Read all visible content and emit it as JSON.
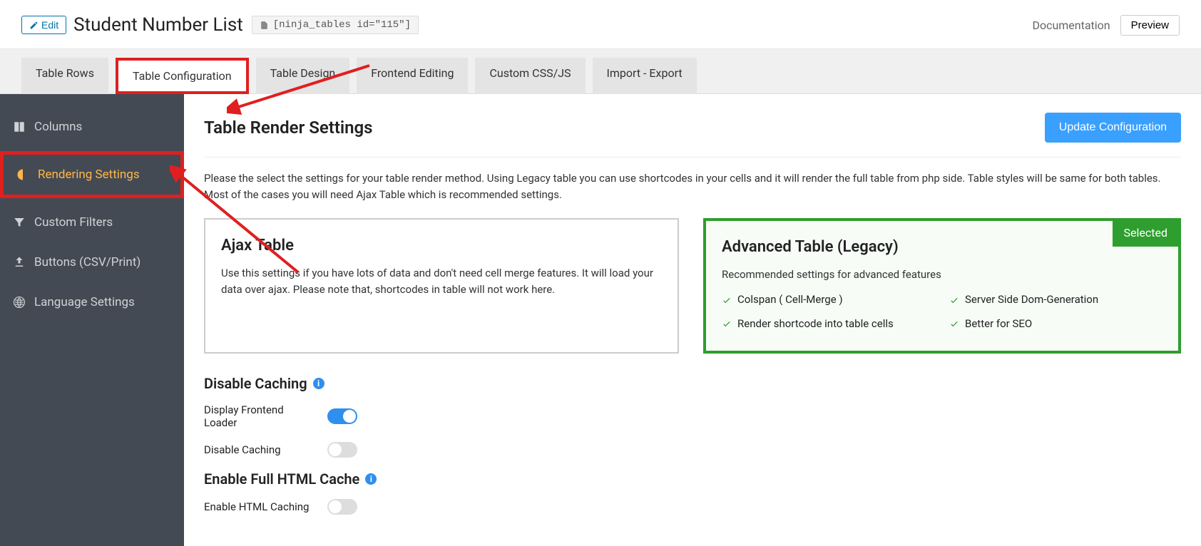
{
  "topbar": {
    "edit_label": "Edit",
    "page_title": "Student Number List",
    "shortcode": "[ninja_tables id=\"115\"]",
    "documentation": "Documentation",
    "preview": "Preview"
  },
  "tabs": [
    {
      "label": "Table Rows"
    },
    {
      "label": "Table Configuration"
    },
    {
      "label": "Table Design"
    },
    {
      "label": "Frontend Editing"
    },
    {
      "label": "Custom CSS/JS"
    },
    {
      "label": "Import - Export"
    }
  ],
  "sidebar": {
    "items": [
      {
        "label": "Columns"
      },
      {
        "label": "Rendering Settings"
      },
      {
        "label": "Custom Filters"
      },
      {
        "label": "Buttons (CSV/Print)"
      },
      {
        "label": "Language Settings"
      }
    ]
  },
  "main": {
    "heading": "Table Render Settings",
    "update_btn": "Update Configuration",
    "description": "Please the select the settings for your table render method. Using Legacy table you can use shortcodes in your cells and it will render the full table from php side. Table styles will be same for both tables. Most of the cases you will need Ajax Table which is recommended settings.",
    "card_ajax": {
      "title": "Ajax Table",
      "desc": "Use this settings if you have lots of data and don't need cell merge features. It will load your data over ajax. Please note that, shortcodes in table will not work here."
    },
    "card_legacy": {
      "title": "Advanced Table (Legacy)",
      "desc": "Recommended settings for advanced features",
      "selected_badge": "Selected",
      "features": [
        "Colspan ( Cell-Merge )",
        "Server Side Dom-Generation",
        "Render shortcode into table cells",
        "Better for SEO"
      ]
    },
    "section_caching": "Disable Caching",
    "opt_loader": "Display Frontend Loader",
    "opt_disable_caching": "Disable Caching",
    "section_html_cache": "Enable Full HTML Cache",
    "opt_html_caching": "Enable HTML Caching"
  }
}
